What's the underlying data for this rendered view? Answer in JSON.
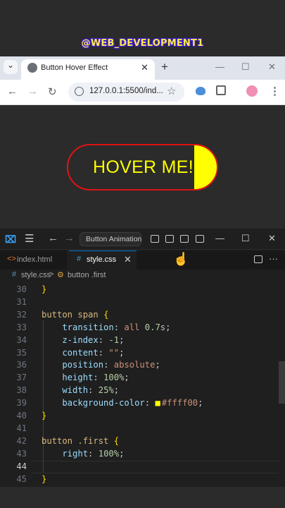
{
  "watermark": "@WEB_DEVELOPMENT1",
  "browser": {
    "tab_title": "Button Hover Effect",
    "tab_close": "✕",
    "new_tab": "+",
    "url": "127.0.0.1:5500/ind...",
    "back_icon": "←",
    "forward_icon": "→",
    "reload_icon": "↻",
    "star_icon": "☆",
    "menu_icon": "⋮",
    "minimize_icon": "—",
    "maximize_icon": "☐",
    "close_icon": "✕",
    "tab_menu_icon": "⌄"
  },
  "page": {
    "button_label": "HOVER ME!",
    "button_border_color": "#e01313",
    "button_text_color": "#ffff00",
    "hover_fill_color": "#ffff00",
    "hover_fill_progress": 0.15
  },
  "vscode": {
    "logo": "⌧",
    "menu_icon": "☰",
    "back_icon": "←",
    "forward_icon": "→",
    "command_center": "Button Animation",
    "minimize_icon": "—",
    "maximize_icon": "☐",
    "close_icon": "✕",
    "tabs": [
      {
        "icon": "<>",
        "label": "index.html"
      },
      {
        "icon": "#",
        "label": "style.css",
        "close": "✕"
      }
    ],
    "more_icon": "···",
    "breadcrumb": {
      "file_icon": "#",
      "file": "style.css",
      "separator": ">",
      "symbol_icon": "⚙",
      "symbol": "button .first"
    },
    "lines": [
      {
        "n": "30",
        "tokens": [
          {
            "t": "}",
            "c": "brace"
          }
        ]
      },
      {
        "n": "31",
        "tokens": []
      },
      {
        "n": "32",
        "tokens": [
          {
            "t": "button span ",
            "c": "sel"
          },
          {
            "t": "{",
            "c": "brace"
          }
        ]
      },
      {
        "n": "33",
        "tokens": [
          {
            "t": "    transition",
            "c": "prop"
          },
          {
            "t": ": ",
            "c": "punc"
          },
          {
            "t": "all ",
            "c": "val"
          },
          {
            "t": "0.7s",
            "c": "num"
          },
          {
            "t": ";",
            "c": "punc"
          }
        ]
      },
      {
        "n": "34",
        "tokens": [
          {
            "t": "    z-index",
            "c": "prop"
          },
          {
            "t": ": ",
            "c": "punc"
          },
          {
            "t": "-1",
            "c": "num"
          },
          {
            "t": ";",
            "c": "punc"
          }
        ]
      },
      {
        "n": "35",
        "tokens": [
          {
            "t": "    content",
            "c": "prop"
          },
          {
            "t": ": ",
            "c": "punc"
          },
          {
            "t": "\"\"",
            "c": "val"
          },
          {
            "t": ";",
            "c": "punc"
          }
        ]
      },
      {
        "n": "36",
        "tokens": [
          {
            "t": "    position",
            "c": "prop"
          },
          {
            "t": ": ",
            "c": "punc"
          },
          {
            "t": "absolute",
            "c": "val"
          },
          {
            "t": ";",
            "c": "punc"
          }
        ]
      },
      {
        "n": "37",
        "tokens": [
          {
            "t": "    height",
            "c": "prop"
          },
          {
            "t": ": ",
            "c": "punc"
          },
          {
            "t": "100%",
            "c": "num"
          },
          {
            "t": ";",
            "c": "punc"
          }
        ]
      },
      {
        "n": "38",
        "tokens": [
          {
            "t": "    width",
            "c": "prop"
          },
          {
            "t": ": ",
            "c": "punc"
          },
          {
            "t": "25%",
            "c": "num"
          },
          {
            "t": ";",
            "c": "punc"
          }
        ]
      },
      {
        "n": "39",
        "tokens": [
          {
            "t": "    background-color",
            "c": "prop"
          },
          {
            "t": ": ",
            "c": "punc"
          },
          {
            "t": "■",
            "c": "swatch"
          },
          {
            "t": "#ffff00",
            "c": "val"
          },
          {
            "t": ";",
            "c": "punc"
          }
        ]
      },
      {
        "n": "40",
        "tokens": [
          {
            "t": "}",
            "c": "brace"
          }
        ]
      },
      {
        "n": "41",
        "tokens": []
      },
      {
        "n": "42",
        "tokens": [
          {
            "t": "button .first ",
            "c": "sel"
          },
          {
            "t": "{",
            "c": "brace"
          }
        ]
      },
      {
        "n": "43",
        "tokens": [
          {
            "t": "    right",
            "c": "prop"
          },
          {
            "t": ": ",
            "c": "punc"
          },
          {
            "t": "100%",
            "c": "num"
          },
          {
            "t": ";",
            "c": "punc"
          }
        ]
      },
      {
        "n": "44",
        "tokens": []
      },
      {
        "n": "45",
        "tokens": [
          {
            "t": "}",
            "c": "brace"
          }
        ]
      }
    ],
    "active_line": "44",
    "swatch_color": "#ffff00"
  }
}
